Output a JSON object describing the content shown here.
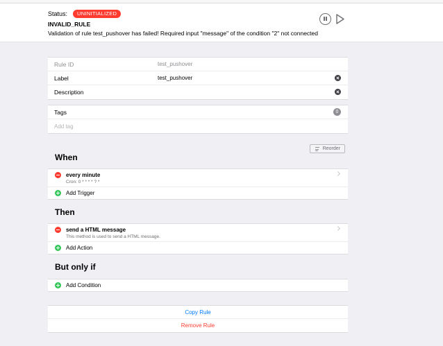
{
  "status": {
    "label": "Status:",
    "badge": "UNINITIALIZED",
    "code": "INVALID_RULE",
    "message": "Validation of rule test_pushover has failed! Required input \"message\" of the condition \"2\" not connected"
  },
  "details": {
    "rule_id_label": "Rule ID",
    "rule_id_value": "test_pushover",
    "label_label": "Label",
    "label_value": "test_pushover",
    "description_label": "Description",
    "description_value": ""
  },
  "tags": {
    "label": "Tags",
    "count": "0",
    "add_placeholder": "Add tag"
  },
  "reorder_label": "Reorder",
  "when": {
    "title": "When",
    "items": [
      {
        "title": "every minute",
        "subtitle": "Cron: 0 * * * * ? *"
      }
    ],
    "add_label": "Add Trigger"
  },
  "then": {
    "title": "Then",
    "items": [
      {
        "title": "send a HTML message",
        "subtitle": "This method is used to send a HTML message."
      }
    ],
    "add_label": "Add Action"
  },
  "only_if": {
    "title": "But only if",
    "add_label": "Add Condition"
  },
  "actions": {
    "copy_label": "Copy Rule",
    "remove_label": "Remove Rule"
  },
  "colors": {
    "accent": "#007aff",
    "danger": "#ff3b30",
    "success": "#34c759"
  }
}
